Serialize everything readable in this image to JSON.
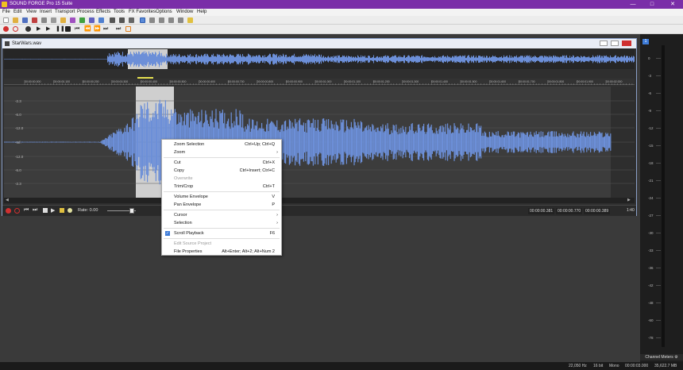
{
  "app": {
    "title": "SOUND FORGE Pro 15 Suite"
  },
  "menu_bar": [
    "File",
    "Edit",
    "View",
    "Insert",
    "Transport",
    "Process",
    "Effects",
    "Tools",
    "FX Favorites",
    "Options",
    "Window",
    "Help"
  ],
  "data_window": {
    "title": "StarWars.wav",
    "selection_marker": "1",
    "rate_label": "Rate: 0.00",
    "time_start": "00:00:00.381",
    "time_end": "00:00:00.770",
    "time_length": "00:00:00.389",
    "zoom_ratio": "1:40",
    "ruler_ticks": [
      "00:00:00.000",
      "00:00:00.100",
      "00:00:00.200",
      "00:00:00.300",
      "00:00:00.400",
      "00:00:00.500",
      "00:00:00.600",
      "00:00:00.700",
      "00:00:00.800",
      "00:00:00.900",
      "00:00:01.000",
      "00:00:01.100",
      "00:00:01.200",
      "00:00:01.300",
      "00:00:01.400",
      "00:00:01.500",
      "00:00:01.600",
      "00:00:01.700",
      "00:00:01.800",
      "00:00:01.900",
      "00:00:02.000",
      "00:00:02.100"
    ],
    "db_labels": [
      "-2.3",
      "-6.0",
      "-12.0",
      "-Inf.",
      "-12.0",
      "-6.0",
      "-2.3"
    ]
  },
  "context_menu": {
    "items": [
      {
        "label": "Zoom Selection",
        "shortcut": "Ctrl+Up; Ctrl+Q"
      },
      {
        "label": "Zoom",
        "submenu": true
      },
      {
        "sep": true
      },
      {
        "label": "Cut",
        "shortcut": "Ctrl+X"
      },
      {
        "label": "Copy",
        "shortcut": "Ctrl+Insert; Ctrl+C"
      },
      {
        "label": "Overwrite",
        "disabled": true
      },
      {
        "label": "Trim/Crop",
        "shortcut": "Ctrl+T"
      },
      {
        "sep": true
      },
      {
        "label": "Volume Envelope",
        "shortcut": "V"
      },
      {
        "label": "Pan Envelope",
        "shortcut": "P"
      },
      {
        "sep": true
      },
      {
        "label": "Cursor",
        "submenu": true
      },
      {
        "label": "Selection",
        "submenu": true
      },
      {
        "sep": true
      },
      {
        "label": "Scroll Playback",
        "shortcut": "F6",
        "checked": true
      },
      {
        "sep": true
      },
      {
        "label": "Edit Source Project",
        "disabled": true
      },
      {
        "label": "File Properties",
        "shortcut": "Alt+Enter; Alt+2; Alt+Num 2"
      }
    ]
  },
  "meters": {
    "label": "Channel Meters",
    "marker": "1",
    "db": [
      "0",
      "-3",
      "-6",
      "-9",
      "-12",
      "-15",
      "-18",
      "-21",
      "-24",
      "-27",
      "-30",
      "-33",
      "-36",
      "-42",
      "-48",
      "-60",
      "-78"
    ]
  },
  "status": {
    "sample_rate": "22,050 Hz",
    "bit_depth": "16 bit",
    "channels": "Mono",
    "length": "00:00:03.000",
    "free_space": "35,622.7 MB"
  },
  "colors": {
    "title_bar": "#7a2ea8",
    "waveform": "#6c8fd8",
    "selection": "#c8c8c8",
    "accent": "#3d7bd8"
  },
  "icons": {
    "app": "sound-forge-app-icon",
    "close": "close-icon",
    "minimize": "minimize-icon",
    "maximize": "maximize-icon"
  }
}
